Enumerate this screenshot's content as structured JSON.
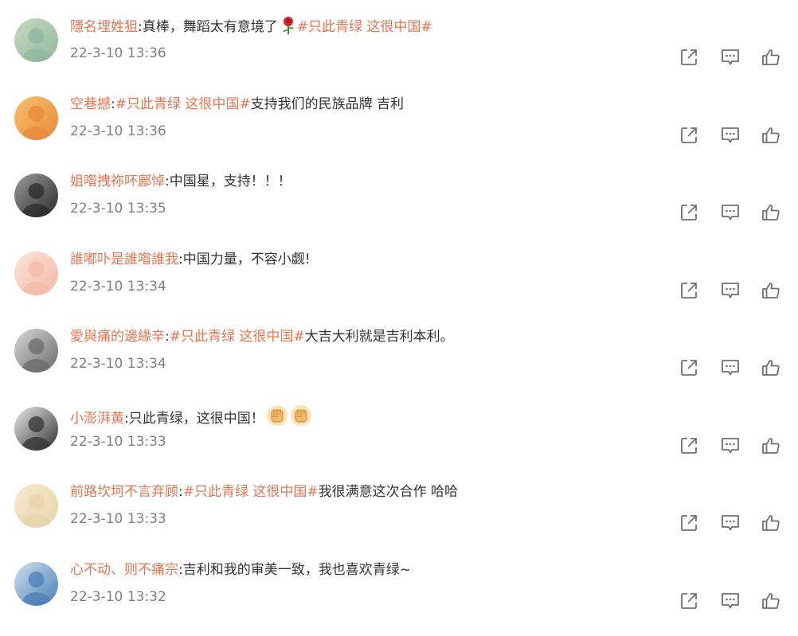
{
  "comments": [
    {
      "username": "隱名埋姓狙",
      "segments": [
        {
          "type": "text",
          "value": ":真棒，舞蹈太有意境了"
        },
        {
          "type": "emoji",
          "value": "rose-icon"
        },
        {
          "type": "topic",
          "value": "#只此青绿 这很中国#"
        }
      ],
      "time": "22-3-10 13:36",
      "avatar_colors": [
        "#8fb7a0",
        "#c9d9c0"
      ]
    },
    {
      "username": "空巷撼",
      "segments": [
        {
          "type": "text",
          "value": ":"
        },
        {
          "type": "topic",
          "value": "#只此青绿 这很中国#"
        },
        {
          "type": "text",
          "value": "支持我们的民族品牌 吉利"
        }
      ],
      "time": "22-3-10 13:36",
      "avatar_colors": [
        "#e98a3a",
        "#f5c16b"
      ]
    },
    {
      "username": "姐喒拽祢吥鄌悼",
      "segments": [
        {
          "type": "text",
          "value": ":中国星，支持！！！"
        }
      ],
      "time": "22-3-10 13:35",
      "avatar_colors": [
        "#2b2b2b",
        "#9a9a9a"
      ]
    },
    {
      "username": "誰嘟卟是誰喒誰我",
      "segments": [
        {
          "type": "text",
          "value": ":中国力量，不容小觑!"
        }
      ],
      "time": "22-3-10 13:34",
      "avatar_colors": [
        "#f4b9a8",
        "#fbe4d6"
      ]
    },
    {
      "username": "愛與痛的邊緣辛",
      "segments": [
        {
          "type": "text",
          "value": ":"
        },
        {
          "type": "topic",
          "value": "#只此青绿 这很中国#"
        },
        {
          "type": "text",
          "value": "大吉大利就是吉利本利。"
        }
      ],
      "time": "22-3-10 13:34",
      "avatar_colors": [
        "#6b6b6b",
        "#d8d8d8"
      ]
    },
    {
      "username": "小澎湃黄",
      "segments": [
        {
          "type": "text",
          "value": ":只此青绿，这很中国！"
        },
        {
          "type": "emoji",
          "value": "fist-icon"
        },
        {
          "type": "emoji",
          "value": "fist-icon"
        }
      ],
      "time": "22-3-10 13:33",
      "avatar_colors": [
        "#333333",
        "#e9e9e9"
      ]
    },
    {
      "username": "前路坎坷不言弃顾",
      "segments": [
        {
          "type": "text",
          "value": ":"
        },
        {
          "type": "topic",
          "value": "#只此青绿 这很中国#"
        },
        {
          "type": "text",
          "value": "我很满意这次合作 哈哈"
        }
      ],
      "time": "22-3-10 13:33",
      "avatar_colors": [
        "#e8d3a8",
        "#f6ead0"
      ]
    },
    {
      "username": "心不动、则不痛宗",
      "segments": [
        {
          "type": "text",
          "value": ":吉利和我的审美一致，我也喜欢青绿~"
        }
      ],
      "time": "22-3-10 13:32",
      "avatar_colors": [
        "#4a7fb5",
        "#cfe0ef"
      ]
    }
  ],
  "actions": {
    "share_icon": "share-icon",
    "reply_icon": "comment-icon",
    "like_icon": "thumbs-up-icon"
  },
  "colors": {
    "username": "#eb7350",
    "topic": "#eb7350",
    "text": "#333333",
    "time": "#808080",
    "icon": "#707070"
  }
}
